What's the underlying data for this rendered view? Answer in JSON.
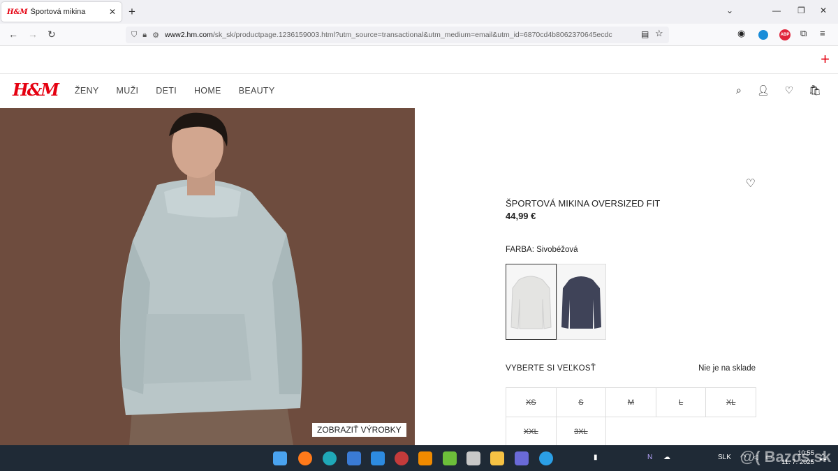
{
  "browser": {
    "tab_title": "Športová mikina",
    "tab_favicon": "H&M",
    "url_host": "www2.hm.com",
    "url_path": "/sk_sk/productpage.1236159003.html?utm_source=transactional&utm_medium=email&utm_id=6870cd4b8062370645ecdc",
    "url_prefix": "",
    "ext_abp": "ABP"
  },
  "site": {
    "logo": "H&M",
    "menu": [
      "ŽENY",
      "MUŽI",
      "DETI",
      "HOME",
      "BEAUTY"
    ]
  },
  "product": {
    "name": "ŠPORTOVÁ MIKINA OVERSIZED FIT",
    "price": "44,99 €",
    "color_label": "FARBA: Sivobéžová",
    "size_heading": "VYBERTE SI VEĽKOSŤ",
    "stock_status": "Nie je na sklade",
    "sizes": [
      "XS",
      "S",
      "M",
      "L",
      "XL",
      "XXL",
      "3XL"
    ],
    "show_products": "ZOBRAZIŤ VÝROBKY",
    "swatch_colors": [
      "#e4e4e2",
      "#3f4358"
    ]
  },
  "taskbar": {
    "lang": "SLK",
    "time": "10:55",
    "date": "11. 7. 2025",
    "watermark": "@( Bazos.sk"
  },
  "colors": {
    "accent": "#e50010",
    "photo_bg": "#6e4c3e",
    "hoodie": "#b9c6c8"
  }
}
